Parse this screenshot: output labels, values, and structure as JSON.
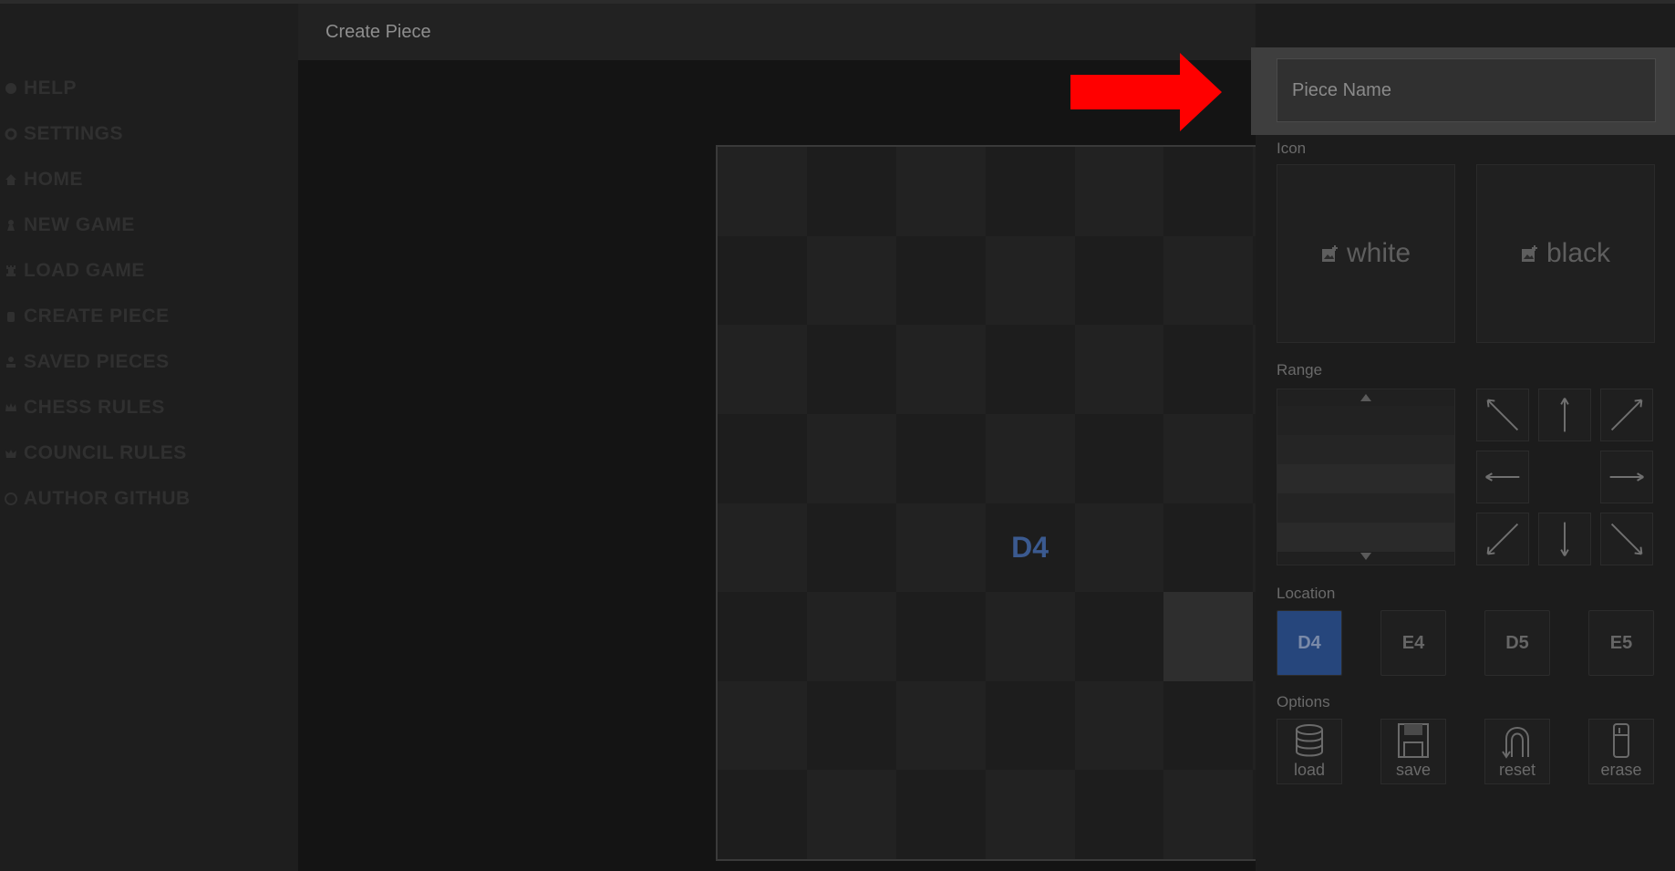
{
  "sidebar": {
    "items": [
      {
        "label": "HELP",
        "icon": "help-icon"
      },
      {
        "label": "SETTINGS",
        "icon": "gear-icon"
      },
      {
        "label": "HOME",
        "icon": "home-icon"
      },
      {
        "label": "NEW GAME",
        "icon": "pawn-icon"
      },
      {
        "label": "LOAD GAME",
        "icon": "rook-icon"
      },
      {
        "label": "CREATE PIECE",
        "icon": "hand-icon"
      },
      {
        "label": "SAVED PIECES",
        "icon": "chess-piece-icon"
      },
      {
        "label": "CHESS RULES",
        "icon": "crown-icon"
      },
      {
        "label": "COUNCIL RULES",
        "icon": "queen-icon"
      },
      {
        "label": "AUTHOR GITHUB",
        "icon": "github-icon"
      }
    ]
  },
  "header": {
    "title": "Create Piece"
  },
  "board": {
    "label_square": "D4",
    "label_text": "D4"
  },
  "panel": {
    "name_placeholder": "Piece Name",
    "icon_label": "Icon",
    "icon_white": "white",
    "icon_black": "black",
    "range_label": "Range",
    "location_label": "Location",
    "locations": [
      "D4",
      "E4",
      "D5",
      "E5"
    ],
    "active_location": "D4",
    "options_label": "Options",
    "options": [
      "load",
      "save",
      "reset",
      "erase"
    ]
  },
  "colors": {
    "accent_blue": "#26467c",
    "label_blue": "#3b5a90",
    "arrow_red": "#ff0000"
  }
}
